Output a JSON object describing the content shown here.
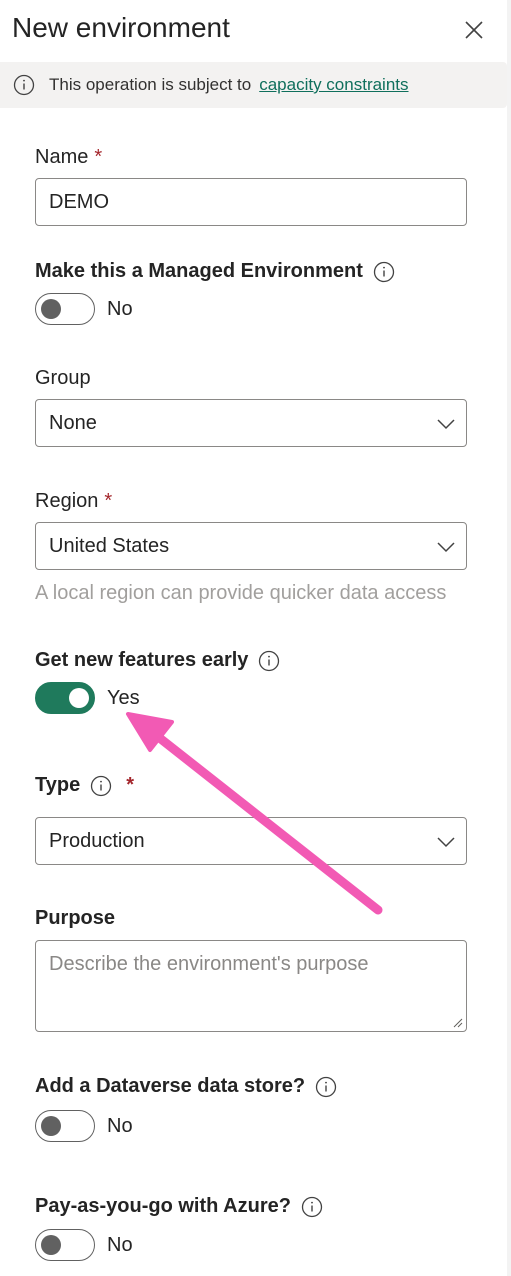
{
  "header": {
    "title": "New environment"
  },
  "notice": {
    "text": "This operation is subject to",
    "link": "capacity constraints"
  },
  "name_field": {
    "label": "Name",
    "required_mark": "*",
    "value": "DEMO"
  },
  "managed": {
    "label": "Make this a Managed Environment",
    "state_label": "No",
    "on": false
  },
  "group": {
    "label": "Group",
    "value": "None"
  },
  "region": {
    "label": "Region",
    "required_mark": "*",
    "value": "United States",
    "hint": "A local region can provide quicker data access"
  },
  "early_features": {
    "label": "Get new features early",
    "state_label": "Yes",
    "on": true
  },
  "type": {
    "label": "Type",
    "required_mark": "*",
    "value": "Production"
  },
  "purpose": {
    "label": "Purpose",
    "placeholder": "Describe the environment's purpose"
  },
  "dataverse": {
    "label": "Add a Dataverse data store?",
    "state_label": "No",
    "on": false
  },
  "payg": {
    "label": "Pay-as-you-go with Azure?",
    "state_label": "No",
    "on": false
  },
  "colors": {
    "accent": "#1f7a5c",
    "link": "#0f6f5c",
    "required": "#a4262c",
    "annotation_arrow": "#f25ab4"
  }
}
